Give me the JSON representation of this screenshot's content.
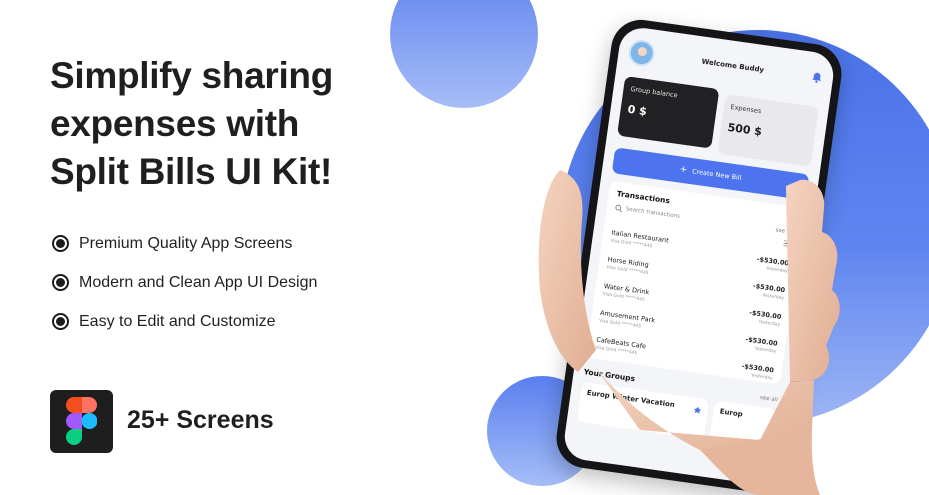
{
  "headline": {
    "line1": "Simplify sharing",
    "line2": "expenses with",
    "line3": "Split Bills UI Kit!"
  },
  "features": [
    "Premium Quality App Screens",
    "Modern and Clean App UI Design",
    "Easy to Edit and Customize"
  ],
  "badge": {
    "icon": "figma-logo-icon",
    "screens_label": "25+ Screens"
  },
  "colors": {
    "accent": "#4d74ee",
    "dark_card": "#212124",
    "decor_blue": "#4a72e8"
  },
  "app": {
    "welcome": "Welcome Buddy",
    "group_balance": {
      "label": "Group balance",
      "value": "0 $"
    },
    "expenses": {
      "label": "Expenses",
      "value": "500 $"
    },
    "create_bill": "Create New Bill",
    "transactions": {
      "title": "Transactions",
      "search_placeholder": "Search transactions",
      "see_all": "see all",
      "items": [
        {
          "name": "Italian Restaurant",
          "card": "Visa Gold *****445",
          "amount": "-$530.00",
          "date": "Yesterday"
        },
        {
          "name": "Horse Riding",
          "card": "Visa Gold *****445",
          "amount": "-$530.00",
          "date": "Yesterday"
        },
        {
          "name": "Water & Drink",
          "card": "Visa Gold *****445",
          "amount": "-$530.00",
          "date": "Yesterday"
        },
        {
          "name": "Amusement Park",
          "card": "Visa Gold *****445",
          "amount": "-$530.00",
          "date": "Yesterday"
        },
        {
          "name": "CafeBeats Cafe",
          "card": "Visa Gold *****445",
          "amount": "-$530.00",
          "date": "Yesterday"
        }
      ]
    },
    "groups": {
      "title": "Your Groups",
      "see_all": "see all",
      "items": [
        "Europ Winter Vacation",
        "Europ"
      ]
    }
  }
}
